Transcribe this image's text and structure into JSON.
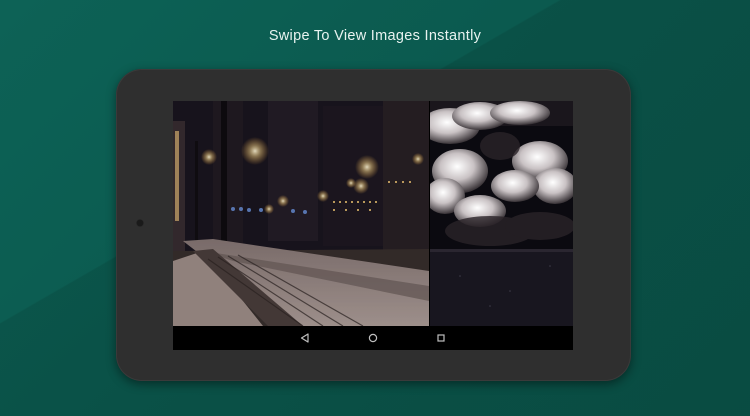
{
  "caption": "Swipe To View Images Instantly",
  "colors": {
    "background": "#0d5e53",
    "tablet_frame": "#2f2f2f",
    "nav_icon": "#bfbfbf"
  },
  "photos": [
    {
      "scene": "night-city-street-snow"
    },
    {
      "scene": "dark-storm-clouds"
    }
  ],
  "navbar": {
    "buttons": [
      {
        "icon": "back-triangle-icon"
      },
      {
        "icon": "home-circle-icon"
      },
      {
        "icon": "recents-square-icon"
      }
    ]
  }
}
